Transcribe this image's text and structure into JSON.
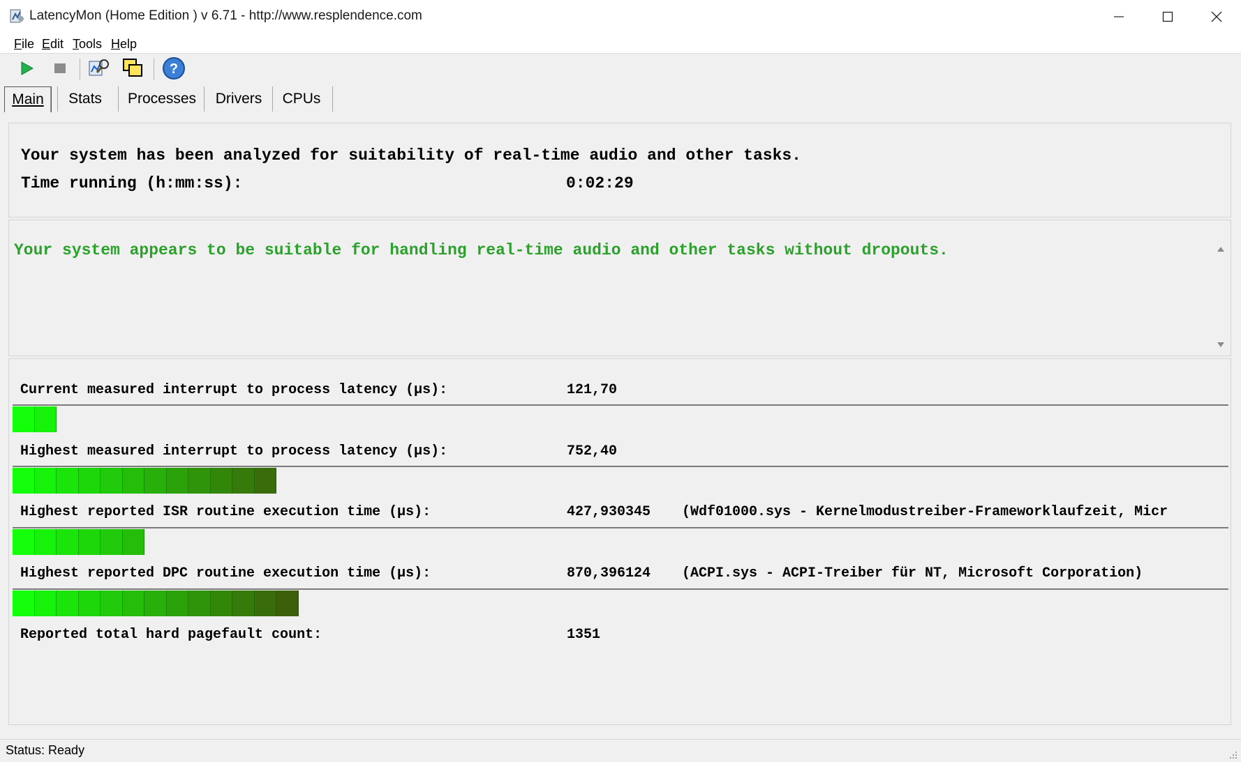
{
  "window": {
    "title": "LatencyMon  (Home Edition )  v 6.71 - http://www.resplendence.com"
  },
  "menu": [
    "File",
    "Edit",
    "Tools",
    "Help"
  ],
  "toolbar": {
    "icons": [
      "play-icon",
      "stop-icon",
      "analyze-icon",
      "windows-icon",
      "help-icon"
    ]
  },
  "tabs": [
    "Main",
    "Stats",
    "Processes",
    "Drivers",
    "CPUs"
  ],
  "summary": {
    "line1": "Your system has been analyzed for suitability of real-time audio and other tasks.",
    "time_label": "Time running (h:mm:ss):",
    "time_value": "0:02:29"
  },
  "verdict": {
    "text": "Your system appears to be suitable for handling real-time audio and other tasks without dropouts.",
    "color": "#2aa12a"
  },
  "metrics": [
    {
      "label": "Current measured interrupt to process latency (µs):",
      "value": "121,70",
      "detail": "",
      "segments": 2
    },
    {
      "label": "Highest measured interrupt to process latency (µs):",
      "value": "752,40",
      "detail": "",
      "segments": 12
    },
    {
      "label": "Highest reported ISR routine execution time (µs):",
      "value": "427,930345",
      "detail": "(Wdf01000.sys - Kernelmodustreiber-Frameworklaufzeit, Micr",
      "segments": 6
    },
    {
      "label": "Highest reported DPC routine execution time (µs):",
      "value": "870,396124",
      "detail": "(ACPI.sys - ACPI-Treiber für NT, Microsoft Corporation)",
      "segments": 13
    }
  ],
  "pagefault": {
    "label": "Reported total hard pagefault count:",
    "value": "1351"
  },
  "status": "Status: Ready"
}
